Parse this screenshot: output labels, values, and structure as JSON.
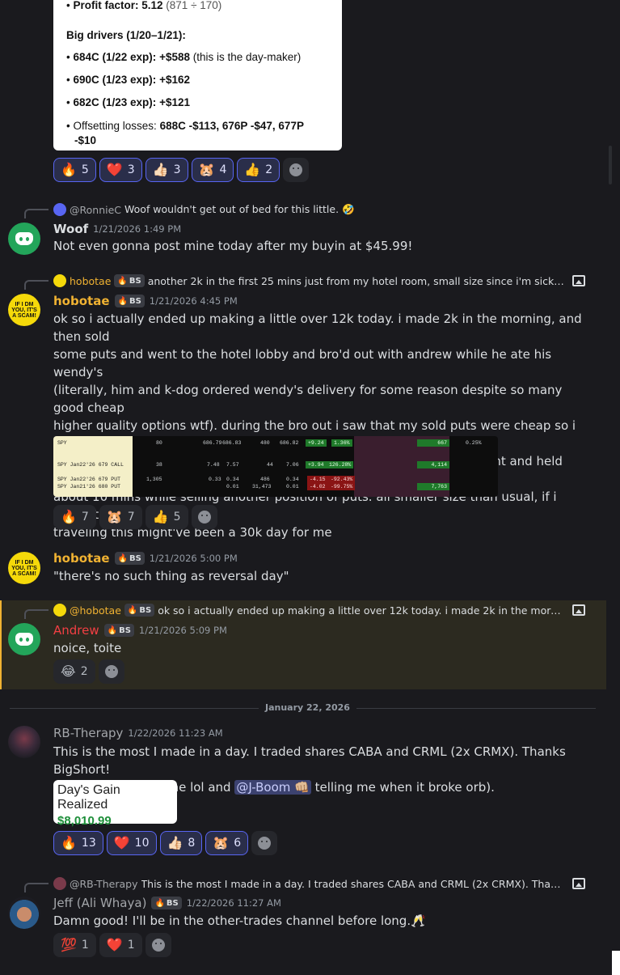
{
  "top_card": {
    "profit_factor_label": "Profit factor:",
    "profit_factor_value": "5.12",
    "profit_factor_detail": "(871 ÷ 170)",
    "drivers_heading": "Big drivers (1/20–1/21):",
    "drivers": [
      {
        "label": "684C (1/22 exp):",
        "value": "+$588",
        "note": "(this is the day-maker)"
      },
      {
        "label": "690C (1/23 exp):",
        "value": "+$162",
        "note": ""
      },
      {
        "label": "682C (1/23 exp):",
        "value": "+$121",
        "note": ""
      }
    ],
    "offset_label": "Offsetting losses:",
    "offset_value_1": "688C -$113, 676P -$47, 677P",
    "offset_value_2": "-$10"
  },
  "reactions_1": [
    {
      "emoji": "🔥",
      "count": "5"
    },
    {
      "emoji": "❤️",
      "count": "3"
    },
    {
      "emoji": "👍🏻",
      "count": "3"
    },
    {
      "emoji": "🐹",
      "count": "4"
    },
    {
      "emoji": "👍",
      "count": "2"
    }
  ],
  "msg_woof": {
    "reply_name": "@RonnieC",
    "reply_text": "Woof wouldn't get out of bed for this little. 🤣",
    "author": "Woof",
    "timestamp": "1/21/2026 1:49 PM",
    "text": "Not even gonna post mine today after my buyin at $45.99!"
  },
  "msg_hobotae_1": {
    "reply_name": "hobotae",
    "reply_badge": "BS",
    "reply_text": "another 2k in the first 25 mins just from my hotel room, small size since i'm sick and tr...",
    "author": "hobotae",
    "badge": "BS",
    "timestamp": "1/21/2026 4:45 PM",
    "lines": [
      "ok so i actually ended up making a little over 12k today. i made 2k in the morning, and then sold",
      "some puts and went to the hotel lobby and bro'd out with andrew while he ate his wendy's",
      "(literally, him and k-dog ordered wendy's delivery for some reason despite so many good cheap",
      "higher quality options wtf). during the bro out i saw that my sold puts were cheap so i bought",
      "them back, and when i got back to my room i saw it had dipped so bought and held some calls for",
      "about 10 mins while selling another position of puts. all smaller size than usual, if i weren't",
      "traveling this might've been a 30k day for me"
    ]
  },
  "trade_table": {
    "rows": [
      {
        "ticker": "SPY",
        "qty": "80",
        "bid": "686.79",
        "ask": "686.83",
        "vol": "480",
        "last": "686.82",
        "chg": "+9.24",
        "pct": "1.36%",
        "pl": "667",
        "pl_pct": "0.25%"
      },
      {
        "ticker": "SPY Jan22'26 679 CALL",
        "qty": "38",
        "bid": "7.48",
        "ask": "7.57",
        "vol": "44",
        "last": "7.06",
        "chg": "+3.94",
        "pct": "126.28%",
        "pl": "4,114",
        "pl_pct": ""
      },
      {
        "ticker": "SPY Jan22'26 679 PUT",
        "qty": "1,305",
        "bid": "0.33",
        "ask": "0.34",
        "vol": "486",
        "last": "0.34",
        "chg": "-4.15",
        "pct": "-92.43%",
        "pl": "",
        "pl_pct": ""
      },
      {
        "ticker": "SPY Jan21'26 680 PUT",
        "qty": "",
        "bid": "",
        "ask": "0.01",
        "vol": "31,473",
        "last": "0.01",
        "chg": "-4.02",
        "pct": "-99.75%",
        "pl": "7,763",
        "pl_pct": ""
      }
    ]
  },
  "reactions_2": [
    {
      "emoji": "🔥",
      "count": "7"
    },
    {
      "emoji": "🐹",
      "count": "7"
    },
    {
      "emoji": "👍",
      "count": "5"
    }
  ],
  "msg_hobotae_2": {
    "author": "hobotae",
    "badge": "BS",
    "timestamp": "1/21/2026 5:00 PM",
    "text": "\"there's no such thing as reversal day\""
  },
  "msg_andrew": {
    "reply_name": "@hobotae",
    "reply_badge": "BS",
    "reply_text": "ok so i actually ended up making a little over 12k today. i made 2k in the morning, an...",
    "author": "Andrew",
    "badge": "BS",
    "timestamp": "1/21/2026 5:09 PM",
    "text": "noice, toite"
  },
  "reactions_3": [
    {
      "emoji": "😂",
      "count": "2"
    }
  ],
  "divider_label": "January 22, 2026",
  "msg_rb": {
    "author": "RB-Therapy",
    "timestamp": "1/22/2026 11:23 AM",
    "line1": "This is the most I made in a day. I traded shares CABA and CRML (2x CRMX). Thanks BigShort!",
    "line2_a": "(Trading on my phone lol and",
    "mention": "@J-Boom 👊🏼",
    "line2_b": "telling me when it broke orb).",
    "gain_label": "Day's Gain Realized",
    "gain_value": "$8,010.99"
  },
  "reactions_4": [
    {
      "emoji": "🔥",
      "count": "13"
    },
    {
      "emoji": "❤️",
      "count": "10"
    },
    {
      "emoji": "👍🏻",
      "count": "8"
    },
    {
      "emoji": "🐹",
      "count": "6"
    }
  ],
  "msg_jeff": {
    "reply_name": "@RB-Therapy",
    "reply_text": "This is the most I made in a day. I traded shares CABA and CRML (2x CRMX). Thanks Bi...",
    "author": "Jeff (Ali Whaya)",
    "badge": "BS",
    "timestamp": "1/22/2026 11:27 AM",
    "text": "Damn good!  I'll be in the other-trades channel before long.🥂"
  },
  "reactions_5": [
    {
      "emoji": "💯",
      "count": "1"
    },
    {
      "emoji": "❤️",
      "count": "1"
    }
  ],
  "avatar_text": "IF I DM YOU, IT'S A SCAM!",
  "colors": {
    "hobotae": "#f0b232",
    "andrew": "#f23f43",
    "woof": "#dbdee1",
    "rb": "#a3a6aa",
    "jeff": "#a3a6aa",
    "accent": "#5865f2"
  }
}
